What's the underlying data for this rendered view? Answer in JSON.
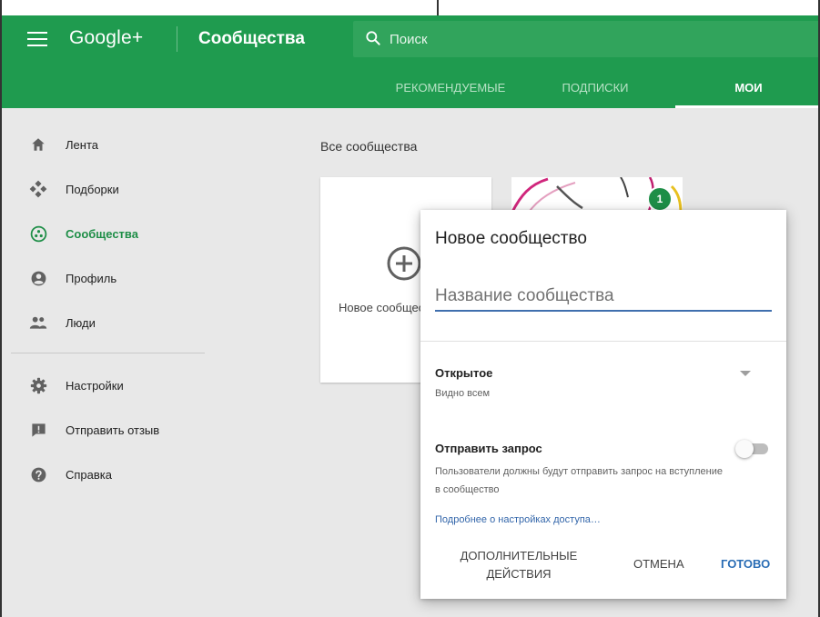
{
  "header": {
    "logo": "Google+",
    "section_title": "Сообщества",
    "search_placeholder": "Поиск"
  },
  "tabs": [
    {
      "label": "РЕКОМЕНДУЕМЫЕ",
      "active": false
    },
    {
      "label": "ПОДПИСКИ",
      "active": false
    },
    {
      "label": "МОИ",
      "active": true
    }
  ],
  "sidebar": {
    "items": [
      {
        "label": "Лента",
        "icon": "home-icon"
      },
      {
        "label": "Подборки",
        "icon": "collections-icon"
      },
      {
        "label": "Сообщества",
        "icon": "communities-icon",
        "active": true
      },
      {
        "label": "Профиль",
        "icon": "profile-icon"
      },
      {
        "label": "Люди",
        "icon": "people-icon"
      },
      {
        "label": "Настройки",
        "icon": "gear-icon"
      },
      {
        "label": "Отправить отзыв",
        "icon": "feedback-icon"
      },
      {
        "label": "Справка",
        "icon": "help-icon"
      }
    ]
  },
  "main": {
    "all_communities_title": "Все сообщества",
    "new_card_label": "Новое сообщество",
    "badge_count": "1"
  },
  "dialog": {
    "title": "Новое сообщество",
    "name_placeholder": "Название сообщества",
    "visibility_label": "Открытое",
    "visibility_sub": "Видно всем",
    "request_label": "Отправить запрос",
    "request_desc": "Пользователи должны будут отправить запрос на вступление в сообщество",
    "request_enabled": false,
    "more_link": "Подробнее о настройках доступа…",
    "buttons": {
      "more": "ДОПОЛНИТЕЛЬНЫЕ ДЕЙСТВИЯ",
      "cancel": "ОТМЕНА",
      "done": "ГОТОВО"
    }
  },
  "colors": {
    "appbar": "#1f9b4f",
    "accent_green": "#1e8e47",
    "link_blue": "#3366aa",
    "done_blue": "#2a6db5"
  }
}
